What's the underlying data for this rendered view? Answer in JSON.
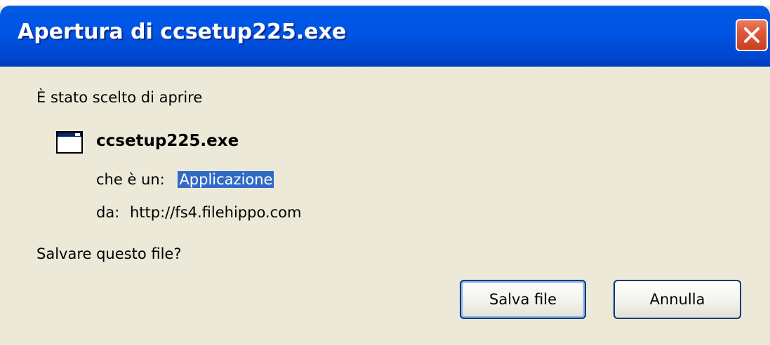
{
  "window": {
    "title": "Apertura di ccsetup225.exe"
  },
  "dialog": {
    "intro": "È stato scelto di aprire",
    "file_name": "ccsetup225.exe",
    "type_label": "che è un:",
    "type_value": "Applicazione",
    "source_label": "da:",
    "source_value": "http://fs4.filehippo.com",
    "question": "Salvare questo file?"
  },
  "buttons": {
    "save_label": "Salva file",
    "cancel_label": "Annulla"
  },
  "icons": {
    "file": "application-window-icon",
    "close": "close-icon"
  },
  "colors": {
    "titlebar": "#0054e3",
    "dialog_bg": "#ece9d8",
    "selection": "#316ac5",
    "close_button": "#e0573a",
    "button_border": "#003c74"
  }
}
